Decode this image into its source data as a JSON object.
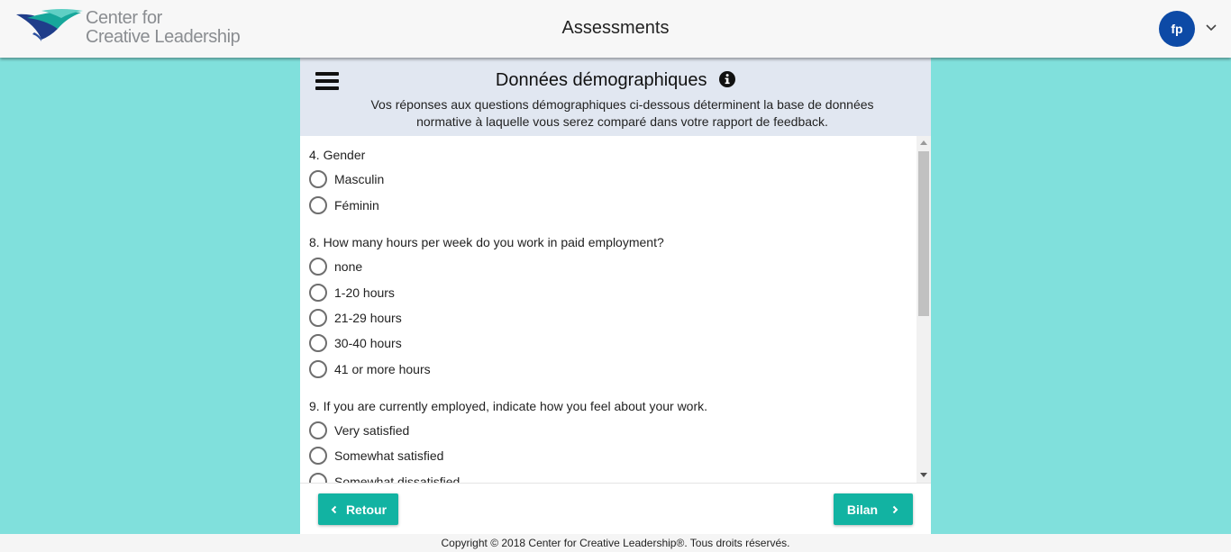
{
  "header": {
    "logo_line1": "Center for",
    "logo_line2": "Creative Leadership",
    "title": "Assessments",
    "avatar_initials": "fp",
    "colors": {
      "bar": "#f7f7f7",
      "avatar": "#0d4aa6"
    }
  },
  "panel": {
    "title": "Données démographiques",
    "subtitle": "Vos réponses aux questions démographiques ci-dessous déterminent la base de données normative à laquelle vous serez comparé dans votre rapport de feedback."
  },
  "questions": [
    {
      "label": "4. Gender",
      "options": [
        "Masculin",
        "Féminin"
      ]
    },
    {
      "label": "8. How many hours per week do you work in paid employment?",
      "options": [
        "none",
        "1-20 hours",
        "21-29 hours",
        "30-40 hours",
        "41 or more hours"
      ]
    },
    {
      "label": "9. If you are currently employed, indicate how you feel about your work.",
      "options": [
        "Very satisfied",
        "Somewhat satisfied",
        "Somewhat dissatisfied"
      ]
    }
  ],
  "buttons": {
    "back": "Retour",
    "next": "Bilan"
  },
  "footer": {
    "copyright": "Copyright © 2018 Center for Creative Leadership®. Tous droits réservés."
  },
  "colors": {
    "background": "#80e0dc",
    "accent": "#12b3a2",
    "panel_header": "#e1e7f1"
  }
}
